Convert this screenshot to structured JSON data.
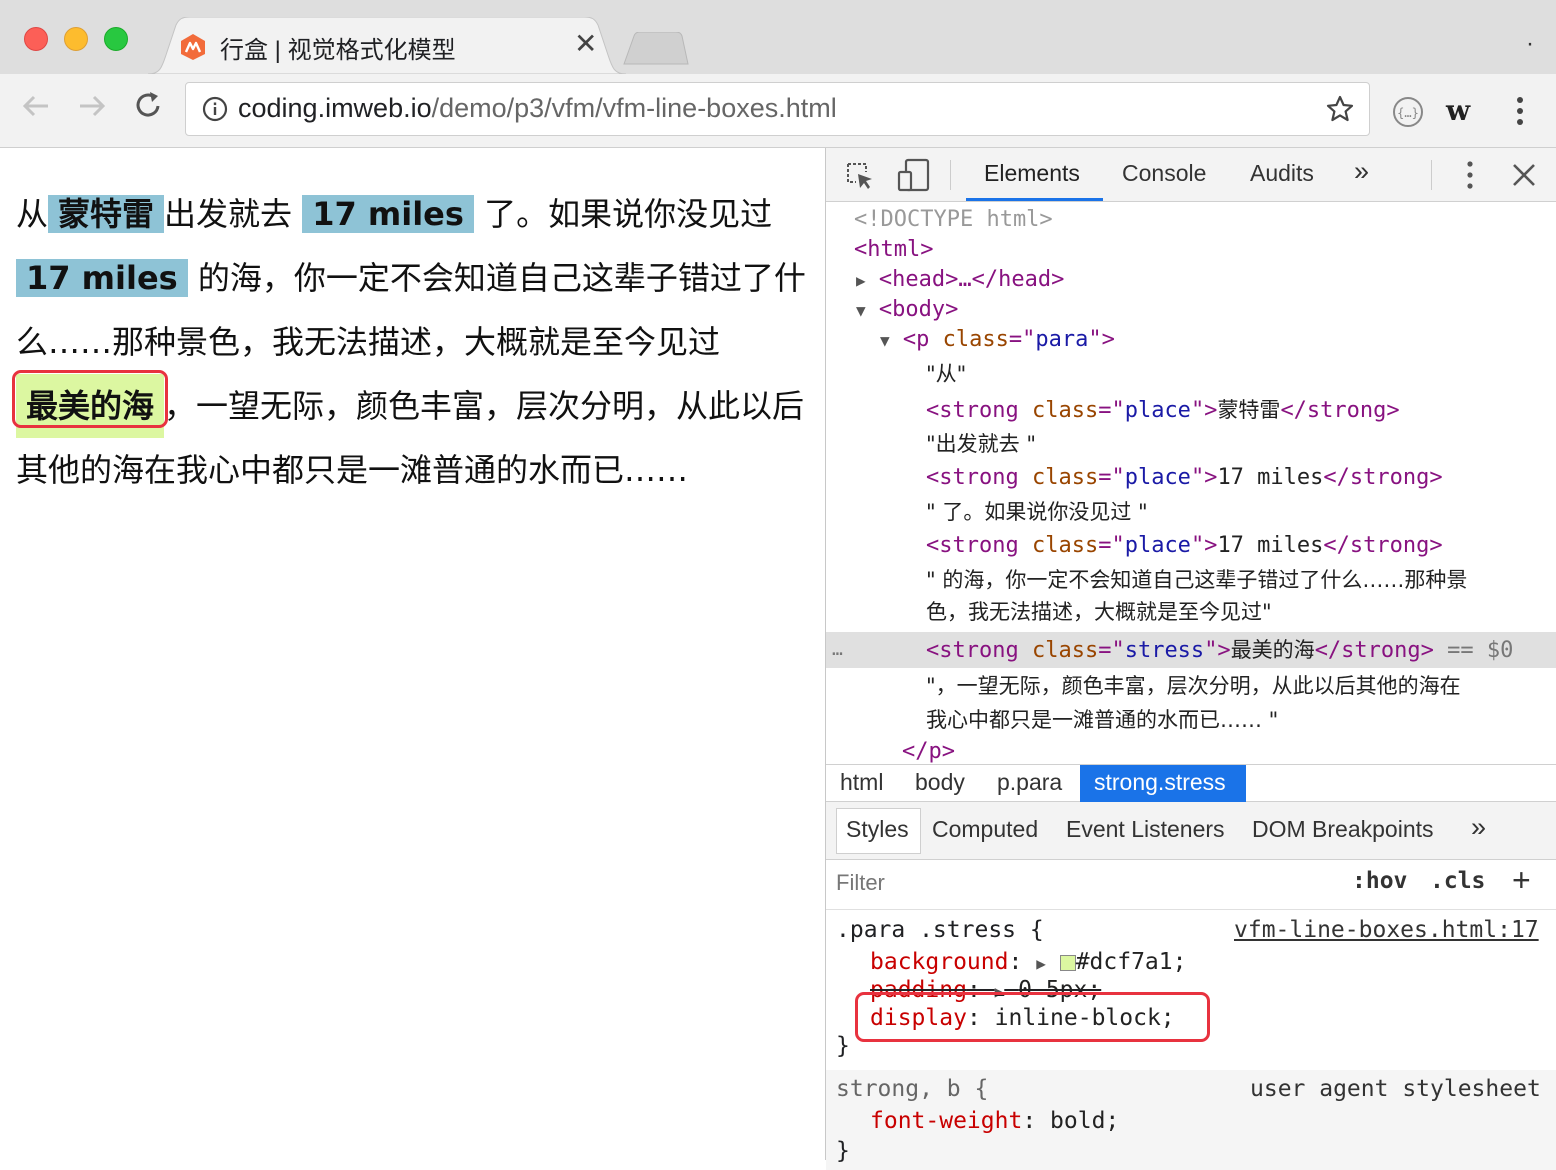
{
  "window": {
    "tab_title": "行盒 | 视觉格式化模型",
    "close_glyph": "✕",
    "url_host": "coding.imweb.io",
    "url_path": "/demo/p3/vfm/vfm-line-boxes.html"
  },
  "paragraph": {
    "t1": "从",
    "place1": "蒙特雷",
    "t2": "出发就去 ",
    "place2": "17 miles",
    "t3": " 了。如果说你没见过 ",
    "place3": "17 miles",
    "t4": " 的海，你一定不会知道自己这辈子错过了什么……那种景色，我无法描述，大概就是至今见过",
    "stress": "最美的海",
    "t5": "，一望无际，颜色丰富，层次分明，从此以后其他的海在我心中都只是一滩普通的水而已……",
    "place_color": "#8ec3d6",
    "stress_color": "#dcf7a1"
  },
  "devtools": {
    "tabs": [
      "Elements",
      "Console",
      "Audits",
      "»"
    ],
    "dom": {
      "doctype": "<!DOCTYPE html>",
      "html_open": "<html>",
      "head": "<head>…</head>",
      "body_open": "<body>",
      "p_tag": "p",
      "p_class": "para",
      "text1": "\"从\"",
      "strong1_class": "place",
      "strong1_text": "蒙特雷",
      "text2": "\"出发就去 \"",
      "strong2_class": "place",
      "strong2_text": "17 miles",
      "text3": "\" 了。如果说你没见过 \"",
      "strong3_class": "place",
      "strong3_text": "17 miles",
      "text4_line1": "\" 的海，你一定不会知道自己这辈子错过了什么……那种景",
      "text4_line2": "色，我无法描述，大概就是至今见过\"",
      "strong4_class": "stress",
      "strong4_text": "最美的海",
      "selected_marker": "== $0",
      "ellipsis": "…",
      "text5_line1": "\"，一望无际，颜色丰富，层次分明，从此以后其他的海在",
      "text5_line2": "我心中都只是一滩普通的水而已…… \"",
      "p_close": "</p>"
    },
    "breadcrumbs": [
      "html",
      "body",
      "p.para",
      "strong.stress"
    ],
    "sub_tabs": [
      "Styles",
      "Computed",
      "Event Listeners",
      "DOM Breakpoints",
      "»"
    ],
    "filter_placeholder": "Filter",
    "hov": ":hov",
    "cls": ".cls",
    "plus": "+",
    "rule1": {
      "selector": ".para .stress {",
      "source": "vfm-line-boxes.html:17",
      "background_prop": "background",
      "background_val": "#dcf7a1;",
      "padding_prop": "padding",
      "padding_val": "0 5px;",
      "display_prop": "display",
      "display_val": "inline-block;",
      "close": "}"
    },
    "rule2": {
      "selector": "strong, b {",
      "source": "user agent stylesheet",
      "fw_prop": "font-weight",
      "fw_val": "bold;",
      "close": "}"
    }
  }
}
